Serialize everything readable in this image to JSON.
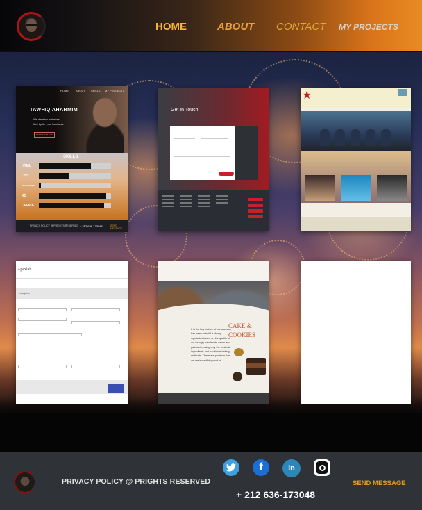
{
  "nav": {
    "home": "HOME",
    "about": "ABOUT",
    "contact": "CONTACT",
    "projects": "MY PROJECTS"
  },
  "projects": [
    {
      "name_label": "TAWFIQ AHARMIM",
      "tagline_1": "We develop websites",
      "tagline_2": "that ignite your business.",
      "send_label": "SEND MESSAGE",
      "nav_items": [
        "HOME",
        "ABOUT",
        "SKILLS",
        "MY PROJECTS"
      ],
      "skills_title": "SKILLS",
      "skills": [
        {
          "label": "HTML",
          "level": 0.72
        },
        {
          "label": "CSS",
          "level": 0.42
        },
        {
          "label": "JAVASCRIPT",
          "level": 0.03
        },
        {
          "label": "XD",
          "level": 0.93
        },
        {
          "label": "OFFICE",
          "level": 0.9
        }
      ],
      "footer_privacy": "PRIVACY POLICY  @  PRIGHTS RESERVED",
      "footer_phone": "+ 212 636-173048",
      "footer_send": "SEND MESSAGE"
    },
    {
      "title": "Get In Touch"
    },
    {},
    {
      "brand": "Apexlab",
      "section": "Inscription"
    },
    {
      "headline_1": "CAKE &",
      "headline_2": "COOKIES",
      "body": "It is the key feature of our success has been to build a strong reputation based on the quality of our lovingly handmade cakes and patisserie, using only the freshest ingredients and traditional baking methods. These are products that we are incredibly proud of."
    },
    {}
  ],
  "footer": {
    "privacy": "PRIVACY POLICY  @   PRIGHTS RESERVED",
    "phone": "+ 212 636-173048",
    "send": "SEND MESSAGE",
    "social": [
      "twitter-icon",
      "facebook-icon",
      "linkedin-icon",
      "instagram-icon"
    ]
  },
  "colors": {
    "accent": "#e39a21",
    "nav_home": "#f7b23a",
    "footer_bg": "#2f3338"
  }
}
